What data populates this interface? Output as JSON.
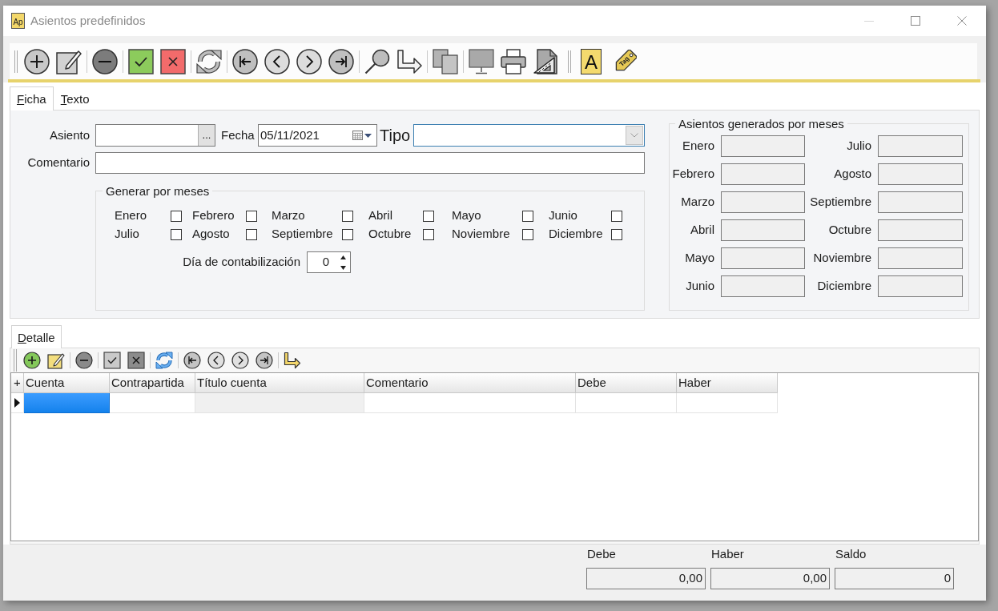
{
  "window": {
    "title": "Asientos predefinidos",
    "logo": "Ap"
  },
  "toolbar": {
    "font_button": "A",
    "tag_button": "Tag"
  },
  "tabs": [
    {
      "label": "Ficha",
      "selected": true
    },
    {
      "label": "Texto",
      "selected": false
    }
  ],
  "ficha": {
    "asiento": {
      "label": "Asiento",
      "button": "..."
    },
    "fecha": {
      "label": "Fecha",
      "value": "05/11/2021"
    },
    "tipo": {
      "label": "Tipo",
      "focused": true
    },
    "comentario": {
      "label": "Comentario"
    },
    "generar_por_meses": {
      "title": "Generar por meses",
      "months": [
        {
          "label": "Enero",
          "checked": false
        },
        {
          "label": "Febrero",
          "checked": false
        },
        {
          "label": "Marzo",
          "checked": false
        },
        {
          "label": "Abril",
          "checked": false
        },
        {
          "label": "Mayo",
          "checked": false
        },
        {
          "label": "Junio",
          "checked": false
        },
        {
          "label": "Julio",
          "checked": false
        },
        {
          "label": "Agosto",
          "checked": false
        },
        {
          "label": "Septiembre",
          "checked": false
        },
        {
          "label": "Octubre",
          "checked": false
        },
        {
          "label": "Noviembre",
          "checked": false
        },
        {
          "label": "Diciembre",
          "checked": false
        }
      ],
      "dia_contabilizacion": {
        "label": "Día de contabilización",
        "value": "0"
      }
    },
    "asientos_generados_por_meses": {
      "title": "Asientos generados por meses",
      "months": [
        {
          "label": "Enero"
        },
        {
          "label": "Febrero"
        },
        {
          "label": "Marzo"
        },
        {
          "label": "Abril"
        },
        {
          "label": "Mayo"
        },
        {
          "label": "Junio"
        },
        {
          "label": "Julio"
        },
        {
          "label": "Agosto"
        },
        {
          "label": "Septiembre"
        },
        {
          "label": "Octubre"
        },
        {
          "label": "Noviembre"
        },
        {
          "label": "Diciembre"
        }
      ]
    }
  },
  "detail": {
    "tabs": [
      {
        "label": "Detalle",
        "selected": true
      }
    ],
    "grid": {
      "corner": "+",
      "columns": [
        {
          "label": "Cuenta",
          "read_only": false
        },
        {
          "label": "Contrapartida",
          "read_only": false
        },
        {
          "label": "Título cuenta",
          "read_only": true
        },
        {
          "label": "Comentario",
          "read_only": false
        },
        {
          "label": "Debe",
          "read_only": false
        },
        {
          "label": "Haber",
          "read_only": false
        }
      ],
      "rows": [
        {
          "current": true,
          "cells": [
            {
              "selected": true
            },
            {
              "selected": false
            },
            {
              "selected": false
            },
            {
              "selected": false
            },
            {
              "selected": false
            },
            {
              "selected": false
            }
          ]
        }
      ]
    }
  },
  "totals": {
    "columns": [
      "Debe",
      "Haber",
      "Saldo"
    ],
    "values": [
      "0,00",
      "0,00",
      "0"
    ]
  }
}
